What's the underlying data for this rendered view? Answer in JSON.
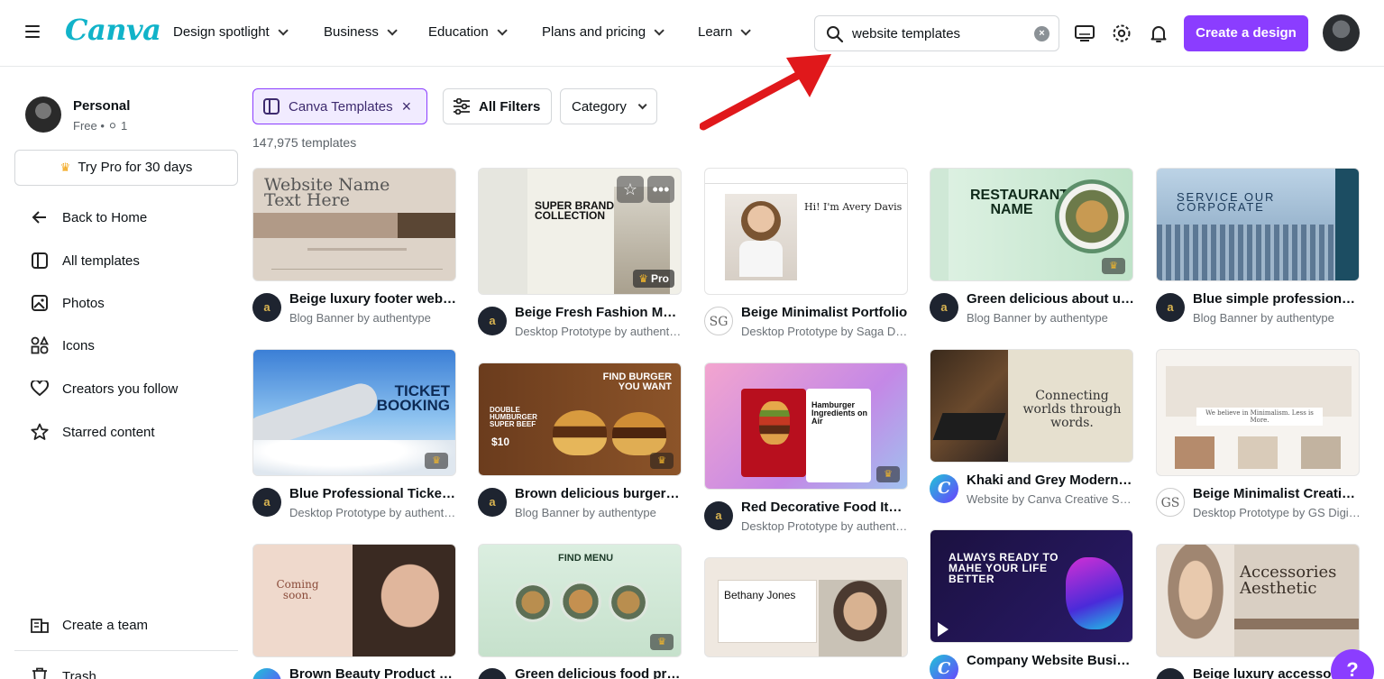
{
  "header": {
    "logo": "Canva",
    "nav": [
      "Design spotlight",
      "Business",
      "Education",
      "Plans and pricing",
      "Learn"
    ],
    "search_value": "website templates",
    "create_label": "Create a design"
  },
  "sidebar": {
    "account_name": "Personal",
    "account_plan": "Free • ",
    "account_members": "1",
    "try_pro": "Try Pro for 30 days",
    "items": [
      "Back to Home",
      "All templates",
      "Photos",
      "Icons",
      "Creators you follow",
      "Starred content"
    ],
    "create_team": "Create a team",
    "trash": "Trash"
  },
  "filters": {
    "canva_templates": "Canva Templates",
    "all_filters": "All Filters",
    "category": "Category",
    "count": "147,975 templates"
  },
  "cards": [
    {
      "title": "Beige luxury footer website",
      "sub": "Blog Banner by authentype",
      "thumb_text": "Website Name Text Here"
    },
    {
      "title": "Beige Fresh Fashion Marketing",
      "sub": "Desktop Prototype by authentype",
      "thumb_text": "SUPER BRAND COLLECTION",
      "badge": "Pro"
    },
    {
      "title": "Beige Minimalist Portfolio",
      "sub": "Desktop Prototype by Saga Design",
      "thumb_text": "Hi! I'm Avery Davis",
      "avatar": "SG"
    },
    {
      "title": "Green delicious about us website",
      "sub": "Blog Banner by authentype",
      "thumb_text": "RESTAURANT NAME"
    },
    {
      "title": "Blue simple professional website",
      "sub": "Blog Banner by authentype",
      "thumb_text": "SERVICE OUR CORPORATE"
    },
    {
      "title": "Blue Professional Ticket Booking",
      "sub": "Desktop Prototype by authentype",
      "thumb_text": "TICKET BOOKING"
    },
    {
      "title": "Brown delicious burger coupon",
      "sub": "Blog Banner by authentype",
      "thumb_text": "FIND BURGER YOU WANT",
      "thumb_text2": "DOUBLE HUMBURGER SUPER BEEF",
      "price": "$10"
    },
    {
      "title": "Red Decorative Food Items",
      "sub": "Desktop Prototype by authentype",
      "thumb_text": "Hamburger Ingredients on Air"
    },
    {
      "title": "Khaki and Grey Modern Photography",
      "sub": "Website by Canva Creative Studio",
      "thumb_text": "Connecting worlds through words.",
      "avatar": "C"
    },
    {
      "title": "Beige Minimalist Creative Studio",
      "sub": "Desktop Prototype by GS Digital",
      "thumb_text": "We believe in Minimalism. Less is More.",
      "avatar": "GS"
    },
    {
      "title": "Brown Beauty Product Landing",
      "sub": "",
      "thumb_text": "Coming soon."
    },
    {
      "title": "Green delicious food promotion",
      "sub": "",
      "thumb_text": "FIND MENU"
    },
    {
      "title": "",
      "sub": "",
      "thumb_text": "Bethany Jones"
    },
    {
      "title": "Company Website Business",
      "sub": "",
      "thumb_text": "ALWAYS READY TO MAHE YOUR LIFE BETTER",
      "avatar": "C"
    },
    {
      "title": "Beige luxury accessories",
      "sub": "",
      "thumb_text": "Accessories Aesthetic"
    }
  ],
  "help": "?",
  "colors": {
    "brand": "#8b3dff",
    "logo": "#11b3c9"
  }
}
